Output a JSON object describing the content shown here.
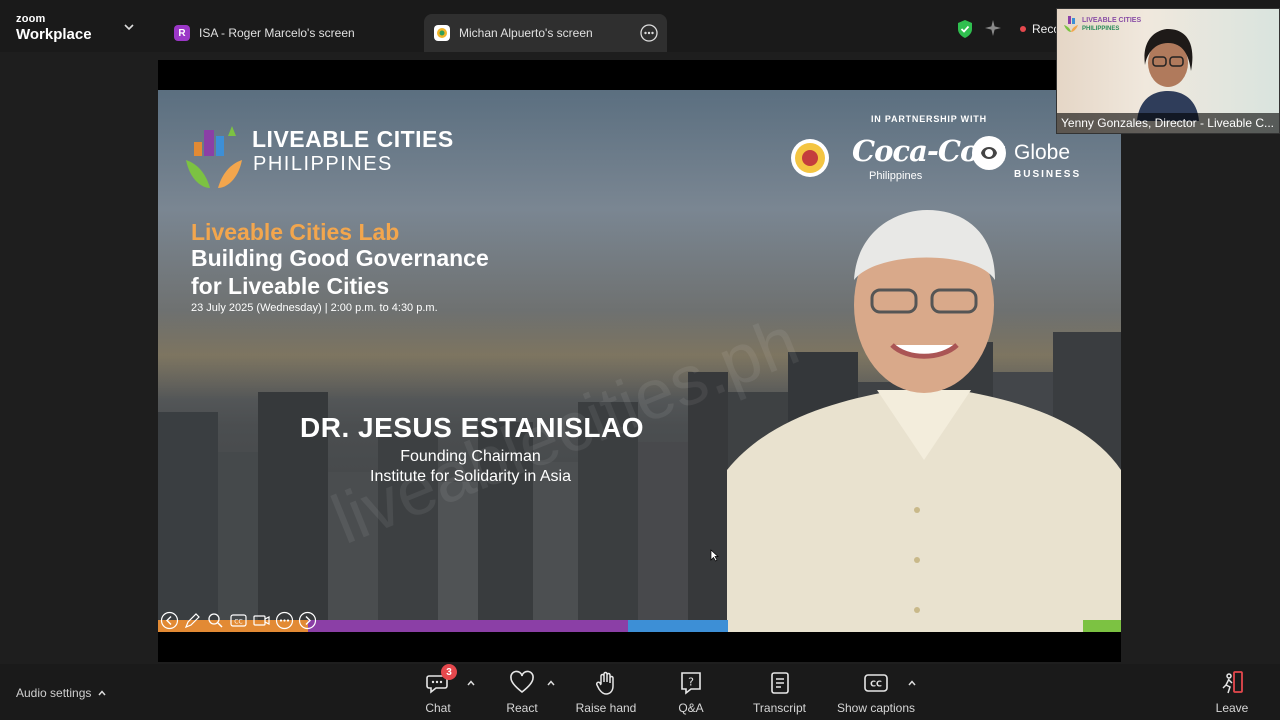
{
  "app": {
    "brand_small": "zoom",
    "brand_large": "Workplace"
  },
  "tabs": [
    {
      "label": "ISA - Roger Marcelo's screen",
      "avatar": "R",
      "active": false
    },
    {
      "label": "Michan Alpuerto's screen",
      "active": true
    }
  ],
  "status": {
    "recording_label": "Reco",
    "shield_icon": "shield-check-icon",
    "ai_icon": "sparkle-icon"
  },
  "slide": {
    "org_line1": "LIVEABLE CITIES",
    "org_line2": "PHILIPPINES",
    "partnership_label": "IN PARTNERSHIP WITH",
    "partner_coke": "Coca-Cola",
    "partner_coke_sub": "Philippines",
    "partner_globe": "Globe",
    "partner_globe_sub": "BUSINESS",
    "event_series": "Liveable Cities Lab",
    "event_title_line1": "Building Good Governance",
    "event_title_line2": "for Liveable Cities",
    "event_date": "23 July 2025 (Wednesday) | 2:00 p.m. to 4:30 p.m.",
    "speaker_name": "DR. JESUS ESTANISLAO",
    "speaker_role1": "Founding Chairman",
    "speaker_role2": "Institute for Solidarity in Asia",
    "watermark": "liveablecities.ph"
  },
  "self_video": {
    "name_label": "Yenny Gonzales, Director - Liveable C...",
    "logo_line1": "LIVEABLE CITIES",
    "logo_line2": "PHILIPPINES"
  },
  "toolbar": {
    "audio_settings": "Audio settings",
    "chat": "Chat",
    "chat_badge": "3",
    "react": "React",
    "raise_hand": "Raise hand",
    "qa": "Q&A",
    "transcript": "Transcript",
    "show_captions": "Show captions",
    "leave": "Leave"
  },
  "colors": {
    "accent_orange": "#f3a64d",
    "record_red": "#e5484d",
    "shield_green": "#2fbf4f",
    "stripe_orange": "#e28a34",
    "stripe_purple": "#8b3fa6",
    "stripe_blue": "#3d8fd6",
    "stripe_green": "#7cc242"
  }
}
